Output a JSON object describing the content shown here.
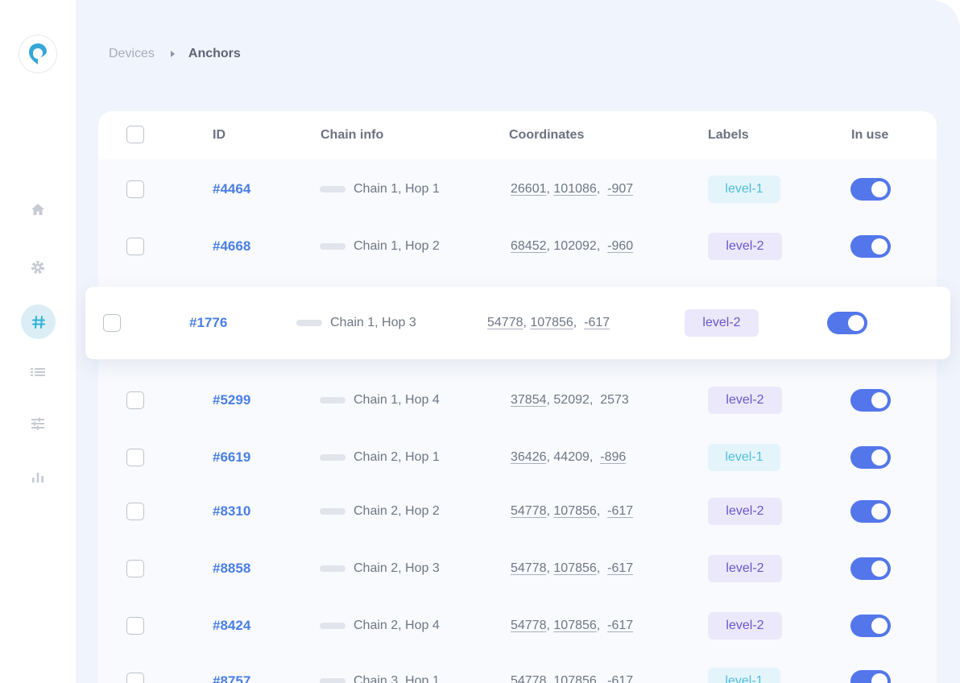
{
  "breadcrumb": {
    "parent": "Devices",
    "current": "Anchors"
  },
  "columns": {
    "id": "ID",
    "chain": "Chain info",
    "coords": "Coordinates",
    "labels": "Labels",
    "in_use": "In use"
  },
  "sidebar": {
    "items": [
      {
        "icon": "home-icon",
        "active": false
      },
      {
        "icon": "gear-icon",
        "active": false
      },
      {
        "icon": "hash-icon",
        "active": true
      },
      {
        "icon": "list-icon",
        "active": false
      },
      {
        "icon": "sliders-icon",
        "active": false
      },
      {
        "icon": "bar-chart-icon",
        "active": false
      }
    ]
  },
  "rows": [
    {
      "id": "#4464",
      "chain": "Chain 1, Hop 1",
      "x": "26601",
      "y": "101086",
      "z": "-907",
      "label": "level-1",
      "in_use": true
    },
    {
      "id": "#4668",
      "chain": "Chain 1, Hop 2",
      "x": "68452",
      "y": "102092",
      "z": "-960",
      "label": "level-2",
      "in_use": true
    },
    {
      "id": "#1776",
      "chain": "Chain 1, Hop 3",
      "x": "54778",
      "y": "107856",
      "z": "-617",
      "label": "level-2",
      "in_use": true
    },
    {
      "id": "#5299",
      "chain": "Chain 1, Hop 4",
      "x": "37854",
      "y": "52092",
      "z": "2573",
      "label": "level-2",
      "in_use": true
    },
    {
      "id": "#6619",
      "chain": "Chain 2, Hop 1",
      "x": "36426",
      "y": "44209",
      "z": "-896",
      "label": "level-1",
      "in_use": true
    },
    {
      "id": "#8310",
      "chain": "Chain 2, Hop 2",
      "x": "54778",
      "y": "107856",
      "z": "-617",
      "label": "level-2",
      "in_use": true
    },
    {
      "id": "#8858",
      "chain": "Chain 2, Hop 3",
      "x": "54778",
      "y": "107856",
      "z": "-617",
      "label": "level-2",
      "in_use": true
    },
    {
      "id": "#8424",
      "chain": "Chain 2, Hop 4",
      "x": "54778",
      "y": "107856",
      "z": "-617",
      "label": "level-2",
      "in_use": true
    },
    {
      "id": "#8757",
      "chain": "Chain 3, Hop 1",
      "x": "54778",
      "y": "107856",
      "z": "-617",
      "label": "level-1",
      "in_use": true
    }
  ],
  "colors": {
    "accent": "#5377ea",
    "id_link": "#4a7ee6",
    "level1_bg": "#e3f5fb",
    "level2_bg": "#ebe8fb"
  }
}
